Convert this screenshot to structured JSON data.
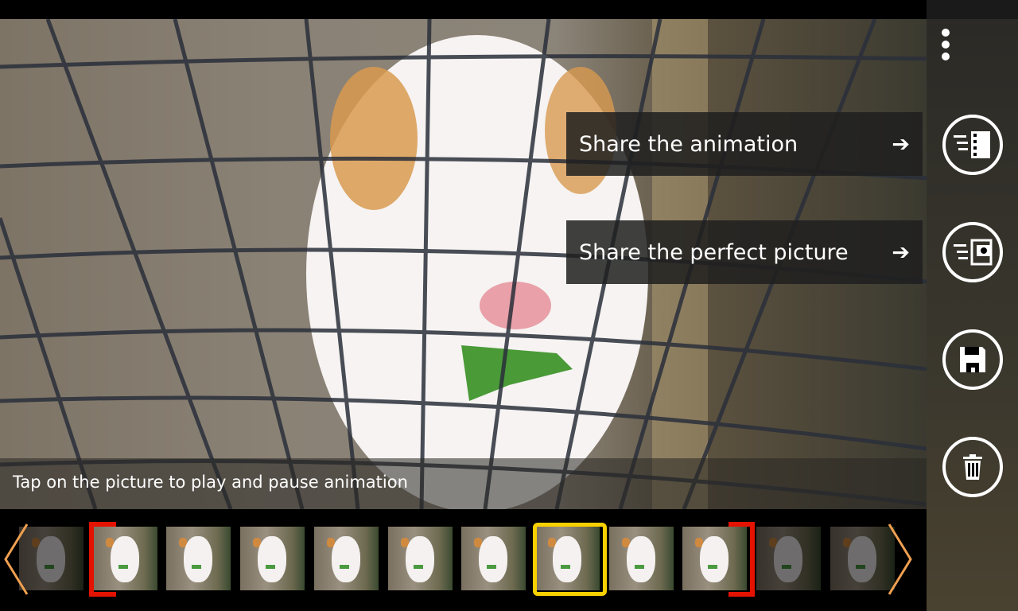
{
  "hint": "Tap on the picture to play and pause animation",
  "menu": {
    "share_animation": "Share the animation",
    "share_picture": "Share the perfect picture",
    "arrow": "➔"
  },
  "side_buttons": [
    {
      "icon": "share-animation-icon",
      "label": "Share the animation"
    },
    {
      "icon": "share-picture-icon",
      "label": "Share the perfect picture"
    },
    {
      "icon": "save-icon",
      "label": "Save"
    },
    {
      "icon": "delete-icon",
      "label": "Delete"
    }
  ],
  "filmstrip": {
    "frame_count": 12,
    "selected_frame": 8,
    "range_start": 2,
    "range_end": 10
  },
  "colors": {
    "selection": "#f8d000",
    "range": "#e41200",
    "nav_arrow": "#f0a050"
  }
}
